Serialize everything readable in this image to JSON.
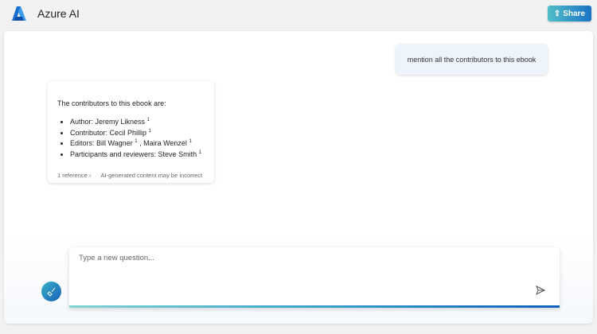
{
  "header": {
    "title": "Azure AI",
    "share_label": "Share"
  },
  "conversation": {
    "user_message": "mention all the contributors to this ebook",
    "answer": {
      "intro": "The contributors to this ebook are:",
      "items": [
        {
          "text": "Author: Jeremy Likness",
          "cite": "1"
        },
        {
          "text": "Contributor: Cecil Phillip",
          "cite": "1"
        },
        {
          "text": "Editors: Bill Wagner",
          "cite": "1",
          "text2": ", Maira Wenzel",
          "cite2": "1"
        },
        {
          "text": "Participants and reviewers: Steve Smith",
          "cite": "1"
        }
      ],
      "references": "1 reference",
      "disclaimer": "AI-generated content may be incorrect"
    }
  },
  "input": {
    "placeholder": "Type a new question..."
  },
  "colors": {
    "accent": "#1a73c6",
    "teal": "#4fbfc9"
  }
}
